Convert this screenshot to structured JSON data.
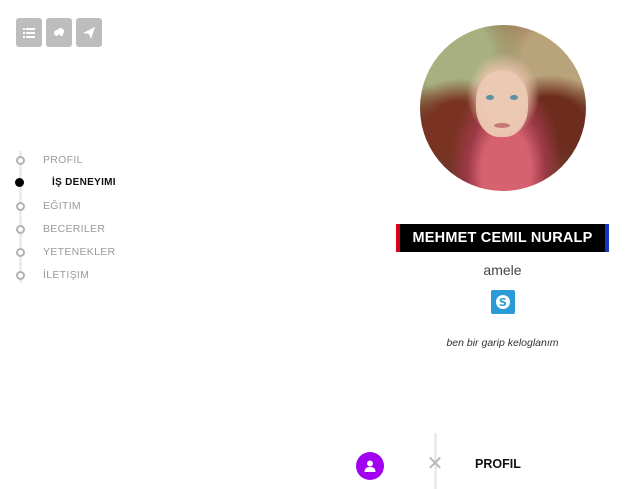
{
  "topbar": {
    "buttons": [
      {
        "icon": "list-icon"
      },
      {
        "icon": "cloud-icon"
      },
      {
        "icon": "paper-plane-icon"
      }
    ]
  },
  "nav": {
    "items": [
      {
        "label": "PROFIL",
        "active": false
      },
      {
        "label": "İŞ DENEYIMI",
        "active": true
      },
      {
        "label": "EĞITIM",
        "active": false
      },
      {
        "label": "BECERILER",
        "active": false
      },
      {
        "label": "YETENEKLER",
        "active": false
      },
      {
        "label": "İLETIŞIM",
        "active": false
      }
    ]
  },
  "profile": {
    "name": "MEHMET CEMIL NURALP",
    "job_title": "amele",
    "skype_glyph": "S",
    "bio": "ben bir garip keloglanım"
  },
  "bottom": {
    "close_glyph": "✕",
    "section_title": "PROFIL"
  },
  "colors": {
    "accent_purple": "#a100f2",
    "name_border_left": "#d8001c",
    "name_border_right": "#1434c8",
    "skype_blue": "#2a9bd8",
    "icon_button_gray": "#bdbdbd"
  }
}
